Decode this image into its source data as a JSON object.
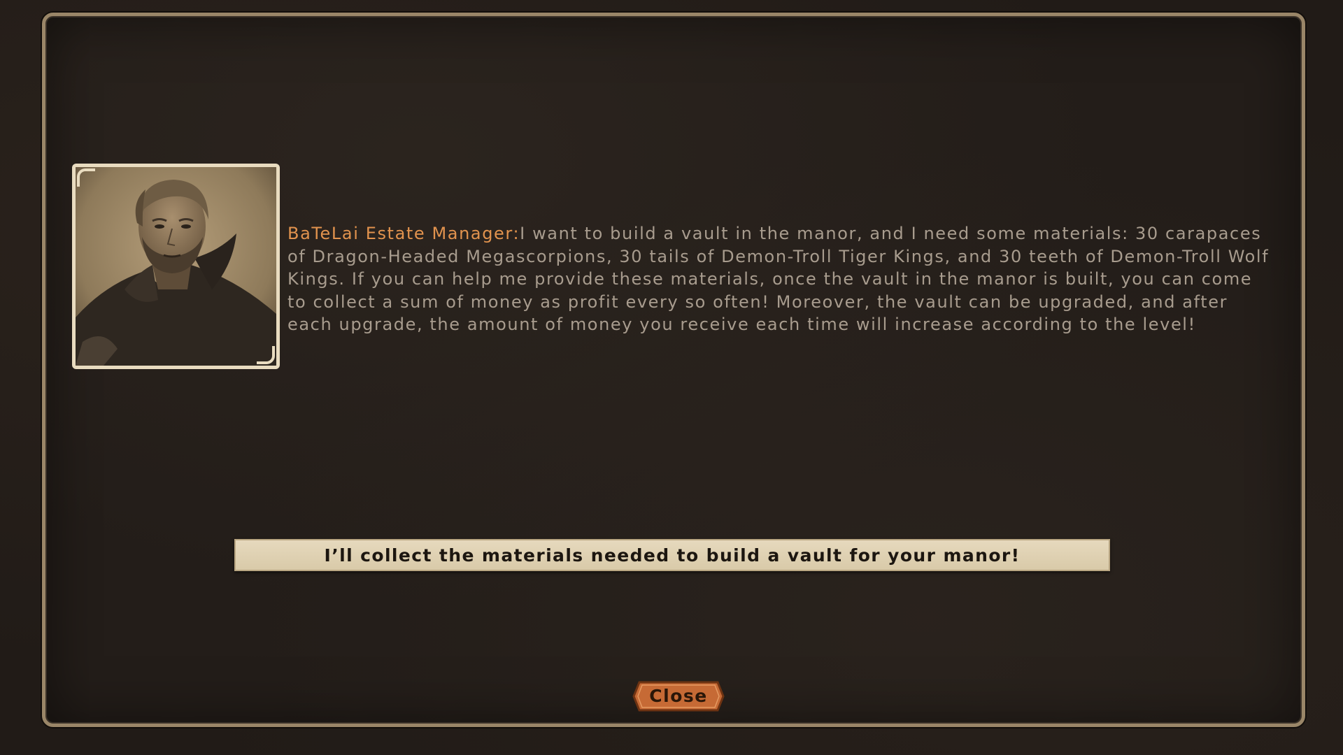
{
  "dialog": {
    "speaker_name": "BaTeLai Estate Manager:",
    "message": "I want to build a vault in the manor, and I need some materials: 30 carapaces of Dragon-Headed Megascorpions, 30 tails of Demon-Troll Tiger Kings, and 30 teeth of Demon-Troll Wolf Kings. If you can help me provide these materials, once the vault in the manor is built, you can come to collect a sum of money as profit every so often! Moreover, the vault can be upgraded, and after each upgrade, the amount of money you receive each time will increase according to the level!",
    "portrait_icon": "npc-portrait-bearded-man"
  },
  "response": {
    "label": "I’ll collect the materials needed to build a vault for your manor!"
  },
  "close_button": {
    "label": "Close"
  },
  "colors": {
    "panel_border": "#9a8668",
    "speaker_name": "#e2934e",
    "body_text": "#a89c8e",
    "parchment": "#e6d9bd",
    "close_button": "#c66a35"
  }
}
